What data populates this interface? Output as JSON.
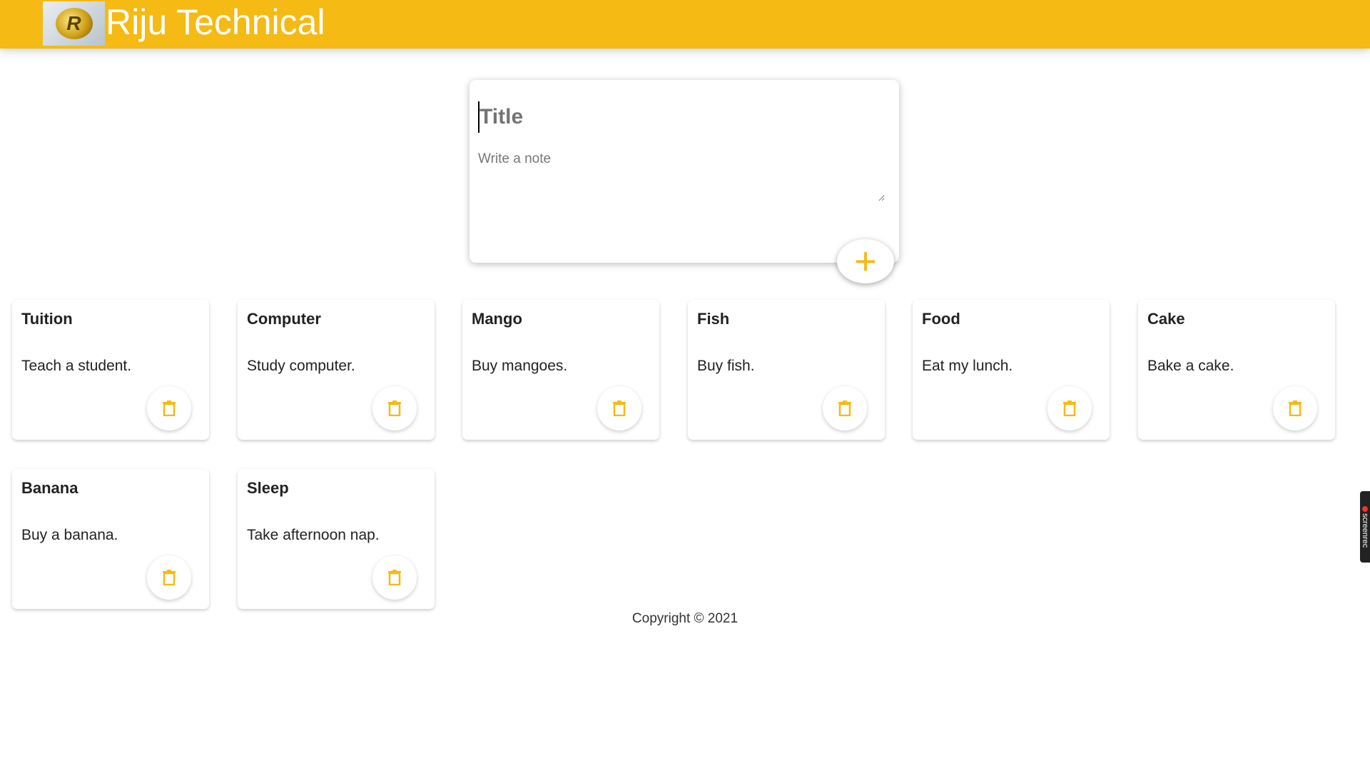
{
  "header": {
    "brand": "Riju Technical",
    "logo_letter": "R"
  },
  "create_note": {
    "title_placeholder": "Title",
    "note_placeholder": "Write a note",
    "add_icon": "+"
  },
  "notes": [
    {
      "title": "Tuition",
      "content": "Teach a student."
    },
    {
      "title": "Computer",
      "content": "Study computer."
    },
    {
      "title": "Mango",
      "content": "Buy mangoes."
    },
    {
      "title": "Fish",
      "content": "Buy fish."
    },
    {
      "title": "Food",
      "content": "Eat my lunch."
    },
    {
      "title": "Cake",
      "content": "Bake a cake."
    },
    {
      "title": "Banana",
      "content": "Buy a banana."
    },
    {
      "title": "Sleep",
      "content": "Take afternoon nap."
    }
  ],
  "footer": {
    "copyright": "Copyright © 2021"
  },
  "recorder": {
    "label": "screenrec"
  },
  "colors": {
    "accent": "#f5ba13"
  }
}
